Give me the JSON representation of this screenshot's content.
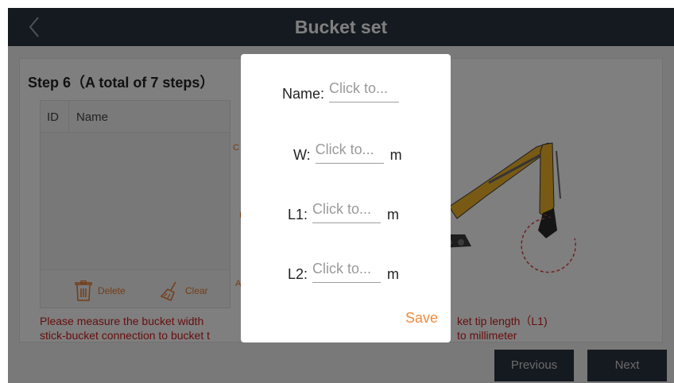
{
  "header": {
    "title": "Bucket set"
  },
  "step": {
    "title": "Step 6（A total of 7 steps）"
  },
  "list": {
    "col_id": "ID",
    "col_name": "Name",
    "delete_label": "Delete",
    "clear_label": "Clear"
  },
  "middle_fragments": {
    "c": "C",
    "i": "I",
    "a": "A"
  },
  "hint": {
    "left_line1": "Please measure the bucket width",
    "left_line2": "stick-bucket connection to bucket t",
    "right_line1": "ket tip length（L1)",
    "right_line2": "to millimeter"
  },
  "footer": {
    "previous_label": "Previous",
    "next_label": "Next"
  },
  "dialog": {
    "name_label": "Name:",
    "name_placeholder": "Click to...",
    "w_label": "W:",
    "w_placeholder": "Click to...",
    "w_unit": "m",
    "l1_label": "L1:",
    "l1_placeholder": "Click to...",
    "l1_unit": "m",
    "l2_label": "L2:",
    "l2_placeholder": "Click to...",
    "l2_unit": "m",
    "save_label": "Save"
  },
  "colors": {
    "titlebar": "#2b3440",
    "accent_orange": "#e87a2d",
    "hint_red": "#cc1d1d",
    "save_orange": "#f08a3c"
  }
}
